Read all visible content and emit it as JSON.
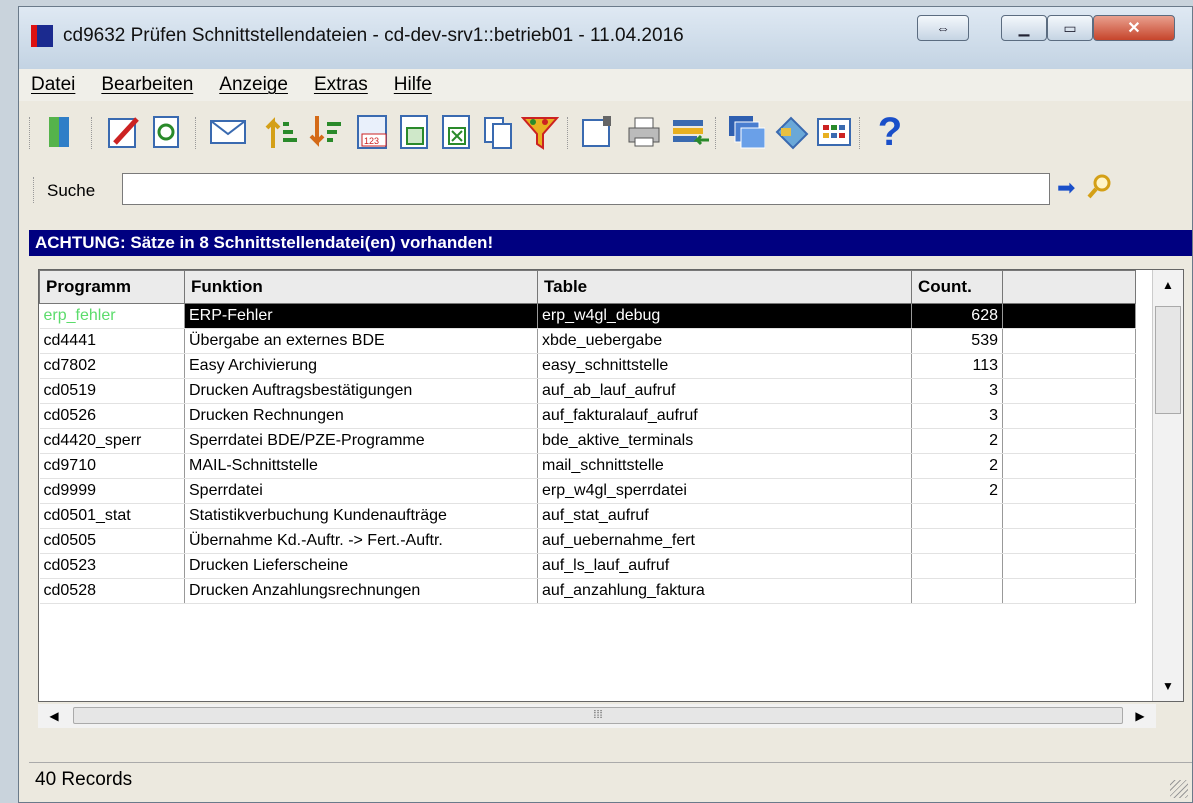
{
  "window": {
    "title": "cd9632 Prüfen Schnittstellendateien - cd-dev-srv1::betrieb01 - 11.04.2016"
  },
  "menu": [
    "Datei",
    "Bearbeiten",
    "Anzeige",
    "Extras",
    "Hilfe"
  ],
  "toolbar_icons": [
    "exit-icon",
    "edit-icon",
    "refresh-icon",
    "mail-icon",
    "sort-ascending-icon",
    "sort-descending-icon",
    "number-format-icon",
    "export-icon",
    "excel-export-icon",
    "copy-icon",
    "filter-icon",
    "properties-icon",
    "print-icon",
    "transfer-icon",
    "windows-icon",
    "tag-icon",
    "grid-icon",
    "help-icon"
  ],
  "search": {
    "label": "Suche",
    "value": ""
  },
  "alert": "ACHTUNG: Sätze in 8 Schnittstellendatei(en) vorhanden!",
  "table": {
    "columns": [
      "Programm",
      "Funktion",
      "Table",
      "Count."
    ],
    "rows": [
      [
        "erp_fehler",
        "ERP-Fehler",
        "erp_w4gl_debug",
        "628"
      ],
      [
        "cd4441",
        "Übergabe an externes BDE",
        "xbde_uebergabe",
        "539"
      ],
      [
        "cd7802",
        "Easy Archivierung",
        "easy_schnittstelle",
        "113"
      ],
      [
        "cd0519",
        "Drucken Auftragsbestätigungen",
        "auf_ab_lauf_aufruf",
        "3"
      ],
      [
        "cd0526",
        "Drucken Rechnungen",
        "auf_fakturalauf_aufruf",
        "3"
      ],
      [
        "cd4420_sperr",
        "Sperrdatei BDE/PZE-Programme",
        "bde_aktive_terminals",
        "2"
      ],
      [
        "cd9710",
        "MAIL-Schnittstelle",
        "mail_schnittstelle",
        "2"
      ],
      [
        "cd9999",
        "Sperrdatei",
        "erp_w4gl_sperrdatei",
        "2"
      ],
      [
        "cd0501_stat",
        "Statistikverbuchung Kundenaufträge",
        "auf_stat_aufruf",
        ""
      ],
      [
        "cd0505",
        "Übernahme Kd.-Auftr. -> Fert.-Auftr.",
        "auf_uebernahme_fert",
        ""
      ],
      [
        "cd0523",
        "Drucken Lieferscheine",
        "auf_ls_lauf_aufruf",
        ""
      ],
      [
        "cd0528",
        "Drucken Anzahlungsrechnungen",
        "auf_anzahlung_faktura",
        ""
      ]
    ]
  },
  "status": "40 Records"
}
